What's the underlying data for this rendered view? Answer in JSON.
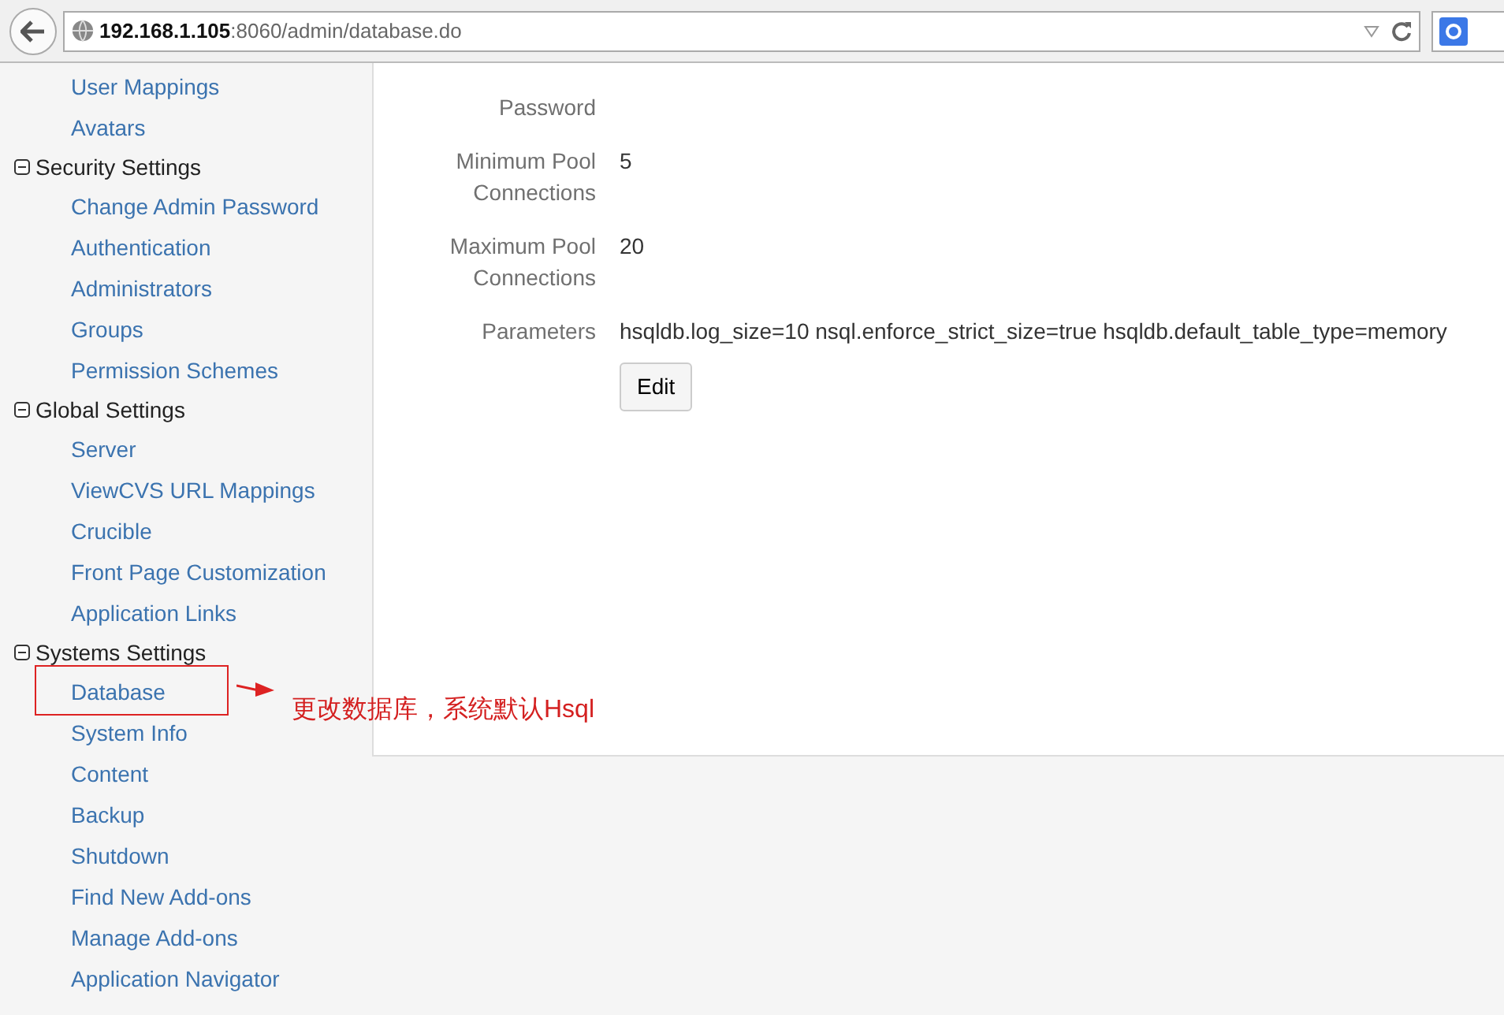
{
  "browser": {
    "url_host": "192.168.1.105",
    "url_path": ":8060/admin/database.do"
  },
  "sidebar": {
    "sections": [
      {
        "items": [
          "User Mappings",
          "Avatars"
        ]
      },
      {
        "title": "Security Settings",
        "expanded": true,
        "items": [
          "Change Admin Password",
          "Authentication",
          "Administrators",
          "Groups",
          "Permission Schemes"
        ]
      },
      {
        "title": "Global Settings",
        "expanded": true,
        "items": [
          "Server",
          "ViewCVS URL Mappings",
          "Crucible",
          "Front Page Customization",
          "Application Links"
        ]
      },
      {
        "title": "Systems Settings",
        "expanded": true,
        "items": [
          "Database",
          "System Info",
          "Content",
          "Backup",
          "Shutdown",
          "Find New Add-ons",
          "Manage Add-ons",
          "Application Navigator"
        ]
      }
    ]
  },
  "form": {
    "fields": [
      {
        "label": "Password"
      },
      {
        "label": "Minimum Pool Connections",
        "value": "5"
      },
      {
        "label": "Maximum Pool Connections",
        "value": "20"
      },
      {
        "label": "Parameters",
        "value": "hsqldb.log_size=10 nsql.enforce_strict_size=true hsqldb.default_table_type=memory"
      }
    ],
    "button": "Edit"
  },
  "annotation": {
    "text": "更改数据库，系统默认Hsql"
  }
}
